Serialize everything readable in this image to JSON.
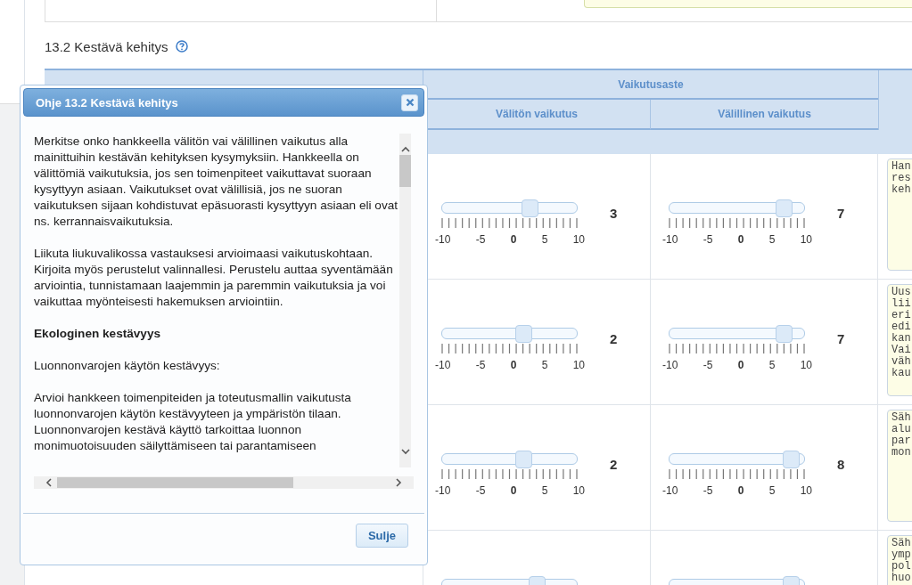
{
  "section": {
    "title": "13.2 Kestävä kehitys"
  },
  "table": {
    "group_header": "Vaikutusaste",
    "columns": [
      "Välitön vaikutus",
      "Välillinen vaikutus"
    ],
    "rows": [
      {
        "direct": {
          "level": 0.65,
          "value": "3",
          "scale": [
            {
              "label": "-10",
              "bold": false
            },
            {
              "label": "-5",
              "bold": false
            },
            {
              "label": "0",
              "bold": true
            },
            {
              "label": "5",
              "bold": false
            },
            {
              "label": "10",
              "bold": false
            }
          ]
        },
        "indirect": {
          "level": 0.85,
          "value": "7",
          "scale": [
            {
              "label": "-10",
              "bold": false
            },
            {
              "label": "-5",
              "bold": false
            },
            {
              "label": "0",
              "bold": true
            },
            {
              "label": "5",
              "bold": false
            },
            {
              "label": "10",
              "bold": false
            }
          ]
        },
        "comment": [
          "Han",
          "res",
          "keh"
        ]
      },
      {
        "direct": {
          "level": 0.6,
          "value": "2",
          "scale": [
            {
              "label": "-10",
              "bold": false
            },
            {
              "label": "-5",
              "bold": false
            },
            {
              "label": "0",
              "bold": true
            },
            {
              "label": "5",
              "bold": false
            },
            {
              "label": "10",
              "bold": false
            }
          ]
        },
        "indirect": {
          "level": 0.85,
          "value": "7",
          "scale": [
            {
              "label": "-10",
              "bold": false
            },
            {
              "label": "-5",
              "bold": false
            },
            {
              "label": "0",
              "bold": true
            },
            {
              "label": "5",
              "bold": false
            },
            {
              "label": "10",
              "bold": false
            }
          ]
        },
        "comment": [
          "Uus",
          "lii",
          "eri",
          "edi",
          "kan",
          "Vai",
          "väh",
          "kau"
        ]
      },
      {
        "direct": {
          "level": 0.6,
          "value": "2",
          "scale": [
            {
              "label": "-10",
              "bold": false
            },
            {
              "label": "-5",
              "bold": false
            },
            {
              "label": "0",
              "bold": true
            },
            {
              "label": "5",
              "bold": false
            },
            {
              "label": "10",
              "bold": false
            }
          ]
        },
        "indirect": {
          "level": 0.9,
          "value": "8",
          "scale": [
            {
              "label": "-10",
              "bold": false
            },
            {
              "label": "-5",
              "bold": false
            },
            {
              "label": "0",
              "bold": true
            },
            {
              "label": "5",
              "bold": false
            },
            {
              "label": "10",
              "bold": false
            }
          ]
        },
        "comment": [
          "Säh",
          "alu",
          "par",
          "mon"
        ]
      },
      {
        "direct": {
          "level": 0.7
        },
        "indirect": {
          "level": 0.9
        },
        "comment": [
          "Säh",
          "ymp",
          "pol",
          "huo"
        ]
      }
    ]
  },
  "dialog": {
    "title": "Ohje 13.2 Kestävä kehitys",
    "paragraphs": [
      {
        "kind": "text",
        "text": "Merkitse onko hankkeella välitön vai välillinen vaikutus alla mainittuihin kestävän kehityksen kysymyksiin. Hankkeella on välittömiä vaikutuksia, jos sen toimenpiteet vaikuttavat suoraan kysyttyyn asiaan. Vaikutukset ovat välillisiä, jos ne suoran vaikutuksen sijaan kohdistuvat epäsuorasti kysyttyyn asiaan eli ovat ns. kerrannaisvaikutuksia."
      },
      {
        "kind": "text",
        "text": "Liikuta liukuvalikossa vastauksesi arvioimaasi vaikutuskohtaan. Kirjoita myös perustelut valinnallesi. Perustelu auttaa syventämään arviointia, tunnistamaan laajemmin ja paremmin vaikutuksia ja voi vaikuttaa myönteisesti hakemuksen arviointiin."
      },
      {
        "kind": "heading",
        "text": "Ekologinen kestävyys"
      },
      {
        "kind": "text",
        "text": "Luonnonvarojen käytön kestävyys:"
      },
      {
        "kind": "text",
        "text": "Arvioi hankkeen toimenpiteiden ja toteutusmallin vaikutusta luonnonvarojen käytön kestävyyteen ja ympäristön tilaan. Luonnonvarojen kestävä käyttö tarkoittaa luonnon monimuotoisuuden säilyttämiseen tai parantamiseen"
      }
    ],
    "button": "Sulje"
  }
}
